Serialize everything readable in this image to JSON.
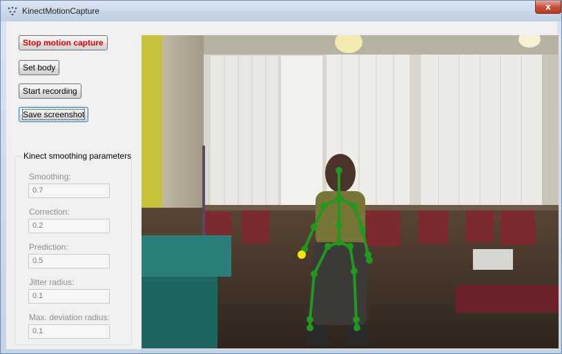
{
  "window": {
    "title": "KinectMotionCapture",
    "app_icon": "kinect-dots-icon",
    "close_glyph": "x"
  },
  "buttons": {
    "stop_capture": "Stop motion capture",
    "set_body": "Set body",
    "start_recording": "Start recording",
    "save_screenshot": "Save screenshot"
  },
  "smoothing": {
    "title": "Kinect smoothing parameters",
    "params": [
      {
        "label": "Smoothing:",
        "value": "0.7"
      },
      {
        "label": "Correction:",
        "value": "0.2"
      },
      {
        "label": "Prediction:",
        "value": "0.5"
      },
      {
        "label": "Jitter radius:",
        "value": "0.1"
      },
      {
        "label": "Max. deviation radius:",
        "value": "0.1"
      }
    ]
  },
  "colors": {
    "skeleton": "#1f9a1f",
    "highlight_joint": "#f6e20f",
    "stop_text": "#e00000"
  }
}
